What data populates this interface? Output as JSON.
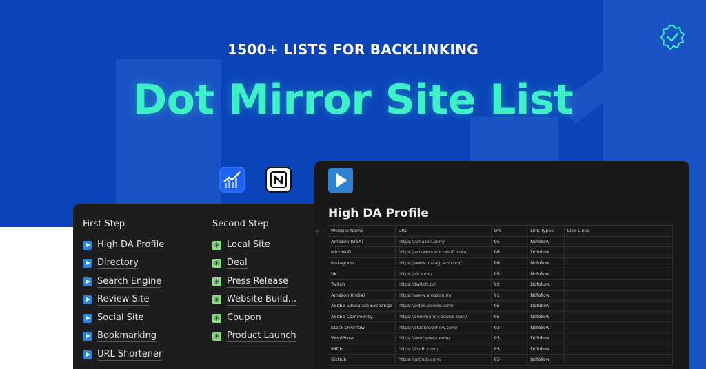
{
  "banner": {
    "subtitle": "1500+ LISTS FOR BACKLINKING",
    "title": "Dot Mirror Site List",
    "colors": {
      "background": "#0a44b8",
      "title": "#3ef0c8",
      "accent": "#2f82d4"
    },
    "icons": [
      "verified-badge-icon",
      "chart-app-icon",
      "notion-app-icon"
    ]
  },
  "nav": {
    "first_step": {
      "title": "First Step",
      "items": [
        "High DA Profile",
        "Directory",
        "Search Engine",
        "Review Site",
        "Social Site",
        "Bookmarking",
        "URL Shortener"
      ]
    },
    "second_step": {
      "title": "Second Step",
      "items": [
        "Local Site",
        "Deal",
        "Press Release",
        "Website Build...",
        "Coupon",
        "Product Launch"
      ]
    }
  },
  "database": {
    "title": "High DA Profile",
    "columns": [
      "Website Name",
      "URL",
      "DR",
      "Link Types",
      "Live Links"
    ],
    "rows": [
      [
        "Amazon (USA)",
        "https://amazon.com/",
        "95",
        "Nofollow",
        ""
      ],
      [
        "Microsoft",
        "https://answers.microsoft.com/",
        "96",
        "Dofollow",
        ""
      ],
      [
        "Instagram",
        "https://www.instagram.com/",
        "99",
        "Nofollow",
        ""
      ],
      [
        "VK",
        "https://vk.com/",
        "95",
        "Nofollow",
        ""
      ],
      [
        "Twitch",
        "https://twitch.tv/",
        "92",
        "Dofollow",
        ""
      ],
      [
        "Amazon (India)",
        "https://www.amazon.in/",
        "91",
        "Nofollow",
        ""
      ],
      [
        "Adobe Education Exchange",
        "https://edex.adobe.com/",
        "95",
        "Dofollow",
        ""
      ],
      [
        "Adobe Community",
        "https://community.adobe.com/",
        "95",
        "Nofollow",
        ""
      ],
      [
        "Stack Overflow",
        "https://stackoverflow.com/",
        "92",
        "Nofollow",
        ""
      ],
      [
        "WordPress",
        "https://wordpress.com/",
        "93",
        "Dofollow",
        ""
      ],
      [
        "IMDb",
        "https://imdb.com/",
        "93",
        "Dofollow",
        ""
      ],
      [
        "GitHub",
        "https://github.com/",
        "95",
        "Nofollow",
        ""
      ]
    ]
  }
}
